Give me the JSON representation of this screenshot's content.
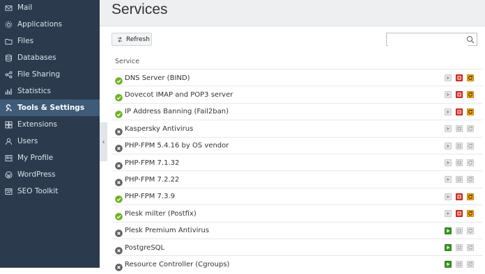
{
  "sidebar": {
    "items": [
      {
        "label": "Mail",
        "icon": "mail-icon",
        "active": false
      },
      {
        "label": "Applications",
        "icon": "gear-icon",
        "active": false
      },
      {
        "label": "Files",
        "icon": "folder-icon",
        "active": false
      },
      {
        "label": "Databases",
        "icon": "database-icon",
        "active": false
      },
      {
        "label": "File Sharing",
        "icon": "share-icon",
        "active": false
      },
      {
        "label": "Statistics",
        "icon": "bar-chart-icon",
        "active": false
      },
      {
        "label": "Tools & Settings",
        "icon": "wrench-icon",
        "active": true
      },
      {
        "label": "Extensions",
        "icon": "puzzle-icon",
        "active": false
      },
      {
        "label": "Users",
        "icon": "user-icon",
        "active": false
      },
      {
        "label": "My Profile",
        "icon": "profile-card-icon",
        "active": false
      },
      {
        "label": "WordPress",
        "icon": "wordpress-icon",
        "active": false
      },
      {
        "label": "SEO Toolkit",
        "icon": "seo-toolkit-icon",
        "active": false
      }
    ]
  },
  "header": {
    "title": "Services"
  },
  "toolbar": {
    "refresh_label": "Refresh",
    "search_placeholder": ""
  },
  "table": {
    "column_header": "Service",
    "rows": [
      {
        "name": "DNS Server (BIND)",
        "status": "running"
      },
      {
        "name": "Dovecot IMAP and POP3 server",
        "status": "running"
      },
      {
        "name": "IP Address Banning (Fail2ban)",
        "status": "running"
      },
      {
        "name": "Kaspersky Antivirus",
        "status": "stopped-disabled"
      },
      {
        "name": "PHP-FPM 5.4.16 by OS vendor",
        "status": "stopped-disabled"
      },
      {
        "name": "PHP-FPM 7.1.32",
        "status": "stopped-disabled"
      },
      {
        "name": "PHP-FPM 7.2.22",
        "status": "stopped-disabled"
      },
      {
        "name": "PHP-FPM 7.3.9",
        "status": "running"
      },
      {
        "name": "Plesk milter (Postfix)",
        "status": "running"
      },
      {
        "name": "Plesk Premium Antivirus",
        "status": "stopped"
      },
      {
        "name": "PostgreSQL",
        "status": "stopped"
      },
      {
        "name": "Resource Controller (Cgroups)",
        "status": "stopped"
      }
    ]
  },
  "colors": {
    "sidebar_bg": "#2b3b4d",
    "sidebar_active": "#3e5b78",
    "running": "#6cb31c",
    "stopped": "#5f5f5f",
    "start_enabled": "#3b9a1e",
    "stop_enabled": "#e0352b",
    "restart_enabled": "#f0a70b",
    "disabled": "#c7c9cb"
  }
}
